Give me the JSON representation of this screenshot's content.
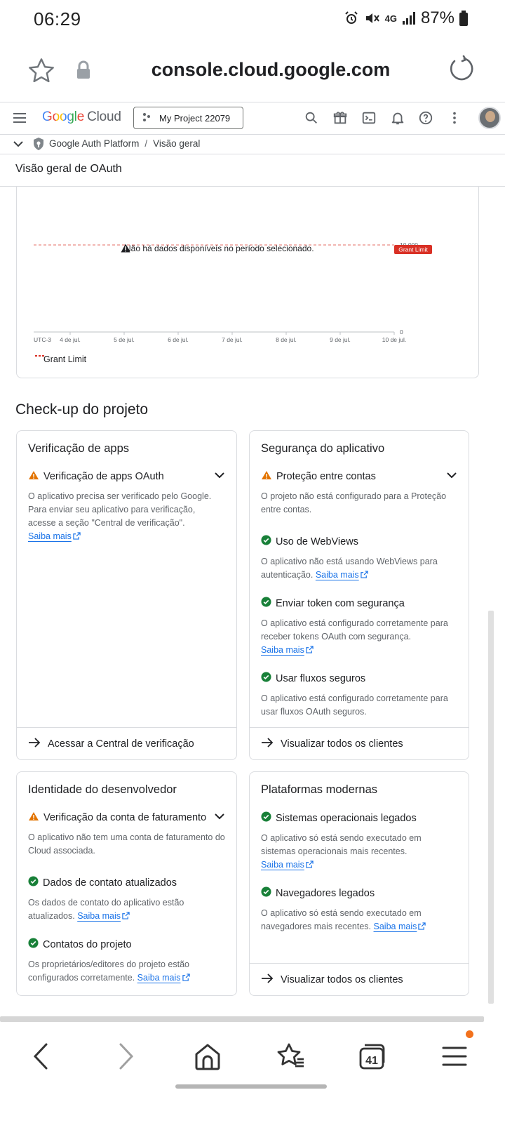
{
  "status_bar": {
    "time": "06:29",
    "network": "4G",
    "battery": "87%"
  },
  "browser": {
    "url": "console.cloud.google.com",
    "tabs_count": "41"
  },
  "header": {
    "logo_google": "Google",
    "logo_cloud": "Cloud",
    "project": "My Project 22079"
  },
  "breadcrumb": {
    "platform": "Google Auth Platform",
    "current": "Visão geral"
  },
  "page_title": "Visão geral de OAuth",
  "chart_data": {
    "type": "line",
    "no_data_message": "Não há dados disponíveis no período selecionado.",
    "x_tick_labels": [
      "UTC-3",
      "4 de jul.",
      "5 de jul.",
      "6 de jul.",
      "7 de jul.",
      "8 de jul.",
      "9 de jul.",
      "10 de jul."
    ],
    "y_tick_labels": [
      "10.000",
      "0"
    ],
    "ylim": [
      0,
      10000
    ],
    "threshold": {
      "name": "Grant Limit",
      "value": 10000,
      "tag": "Grant Limit",
      "color": "#d93025"
    },
    "series": [],
    "legend": [
      {
        "name": "Grant Limit",
        "color": "#d93025",
        "style": "dashed"
      }
    ],
    "legend_placement": "bottom-left"
  },
  "section_title": "Check-up do projeto",
  "cards": {
    "apps": {
      "title": "Verificação de apps",
      "item1": {
        "label": "Verificação de apps OAuth",
        "desc": "O aplicativo precisa ser verificado pelo Google. Para enviar seu aplicativo para verificação, acesse a seção \"Central de verificação\".",
        "link": "Saiba mais"
      },
      "footer": "Acessar a Central de verificação"
    },
    "security": {
      "title": "Segurança do aplicativo",
      "item1": {
        "label": "Proteção entre contas",
        "desc": "O projeto não está configurado para a Proteção entre contas."
      },
      "item2": {
        "label": "Uso de WebViews",
        "desc": "O aplicativo não está usando WebViews para autenticação.",
        "link": "Saiba mais"
      },
      "item3": {
        "label": "Enviar token com segurança",
        "desc": "O aplicativo está configurado corretamente para receber tokens OAuth com segurança.",
        "link": "Saiba mais"
      },
      "item4": {
        "label": "Usar fluxos seguros",
        "desc": "O aplicativo está configurado corretamente para usar fluxos OAuth seguros."
      },
      "footer": "Visualizar todos os clientes"
    },
    "developer": {
      "title": "Identidade do desenvolvedor",
      "item1": {
        "label": "Verificação da conta de faturamento",
        "desc": "O aplicativo não tem uma conta de faturamento do Cloud associada."
      },
      "item2": {
        "label": "Dados de contato atualizados",
        "desc": "Os dados de contato do aplicativo estão atualizados.",
        "link": "Saiba mais"
      },
      "item3": {
        "label": "Contatos do projeto",
        "desc": "Os proprietários/editores do projeto estão configurados corretamente.",
        "link": "Saiba mais"
      }
    },
    "platforms": {
      "title": "Plataformas modernas",
      "item1": {
        "label": "Sistemas operacionais legados",
        "desc": "O aplicativo só está sendo executado em sistemas operacionais mais recentes.",
        "link": "Saiba mais"
      },
      "item2": {
        "label": "Navegadores legados",
        "desc": "O aplicativo só está sendo executado em navegadores mais recentes.",
        "link": "Saiba mais"
      },
      "footer": "Visualizar todos os clientes"
    }
  },
  "colors": {
    "warning": "#e37400",
    "success": "#188038",
    "link": "#1a73e8",
    "threshold": "#d93025"
  },
  "icons": {
    "status": [
      "alarm-icon",
      "mute-icon",
      "signal-icon",
      "battery-icon"
    ],
    "browser": [
      "bookmark-star-icon",
      "lock-icon",
      "reload-icon"
    ],
    "header": [
      "menu-icon",
      "search-icon",
      "gift-icon",
      "terminal-icon",
      "bell-icon",
      "help-icon",
      "more-vert-icon"
    ],
    "bottom_nav": [
      "back-icon",
      "forward-icon",
      "home-icon",
      "bookmarks-icon",
      "tabs-icon",
      "menu-icon"
    ]
  }
}
